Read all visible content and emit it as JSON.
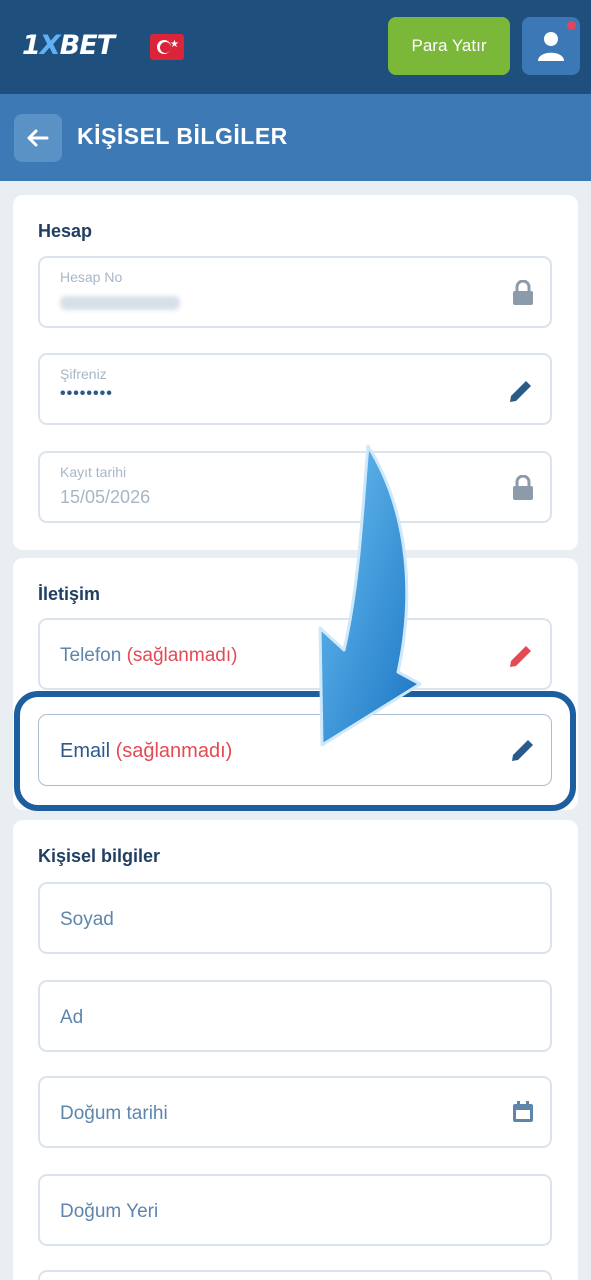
{
  "header": {
    "logo": {
      "prefix": "1",
      "x": "X",
      "suffix": "BET"
    },
    "deposit_label": "Para Yatır"
  },
  "titlebar": {
    "title": "KİŞİSEL BİLGİLER"
  },
  "account": {
    "title": "Hesap",
    "account_no_label": "Hesap No",
    "password_label": "Şifreniz",
    "password_value": "••••••••",
    "reg_date_label": "Kayıt tarihi",
    "reg_date_value": "15/05/2026"
  },
  "contact": {
    "title": "İletişim",
    "phone_label": "Telefon",
    "phone_status": "(sağlanmadı)",
    "email_label": "Email",
    "email_status": "(sağlanmadı)"
  },
  "personal": {
    "title": "Kişisel bilgiler",
    "surname": "Soyad",
    "name": "Ad",
    "birth_date": "Doğum tarihi",
    "birth_place": "Doğum Yeri"
  },
  "colors": {
    "header": "#1f4f7c",
    "titlebar": "#3d7ab5",
    "deposit": "#7bb83a",
    "highlight": "#1d5f9e",
    "warning": "#e24a55"
  },
  "icons": [
    "back-arrow-icon",
    "user-icon",
    "lock-icon",
    "pencil-icon",
    "calendar-icon",
    "turkey-flag-icon",
    "pointer-arrow-icon"
  ]
}
